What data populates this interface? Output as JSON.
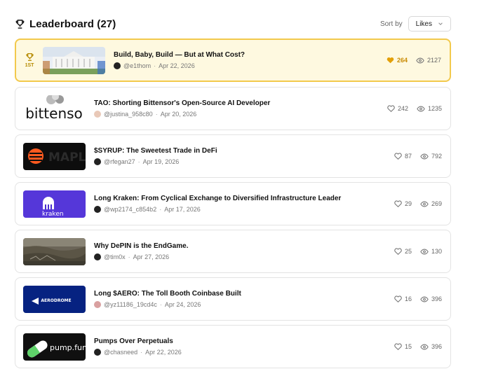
{
  "header": {
    "title": "Leaderboard (27)",
    "sort_label": "Sort by",
    "sort_value": "Likes"
  },
  "posts": [
    {
      "rank_label": "1ST",
      "title": "Build, Baby, Build — But at What Cost?",
      "author": "@e1thom",
      "date": "Apr 22, 2026",
      "likes": "264",
      "views": "2127"
    },
    {
      "title": "TAO: Shorting Bittensor's Open-Source AI Developer",
      "author": "@justina_958c80",
      "date": "Apr 20, 2026",
      "likes": "242",
      "views": "1235",
      "thumb_text": "bittenso"
    },
    {
      "title": "$SYRUP: The Sweetest Trade in DeFi",
      "author": "@rfegan27",
      "date": "Apr 19, 2026",
      "likes": "87",
      "views": "792",
      "thumb_text": "MAPLE"
    },
    {
      "title": "Long Kraken: From Cyclical Exchange to Diversified Infrastructure Leader",
      "author": "@wp2174_c854b2",
      "date": "Apr 17, 2026",
      "likes": "29",
      "views": "269",
      "thumb_text": "kraken"
    },
    {
      "title": "Why DePIN is the EndGame.",
      "author": "@tim0x",
      "date": "Apr 27, 2026",
      "likes": "25",
      "views": "130"
    },
    {
      "title": "Long $AERO: The Toll Booth Coinbase Built",
      "author": "@yz11186_19cd4c",
      "date": "Apr 24, 2026",
      "likes": "16",
      "views": "396",
      "thumb_text": "AERODROME"
    },
    {
      "title": "Pumps Over Perpetuals",
      "author": "@chasneed",
      "date": "Apr 22, 2026",
      "likes": "15",
      "views": "396",
      "thumb_text": "pump.fun"
    }
  ],
  "colors": {
    "highlight_bg": "#fef9e0",
    "highlight_border": "#f2c94c",
    "gold": "#c98a00"
  }
}
